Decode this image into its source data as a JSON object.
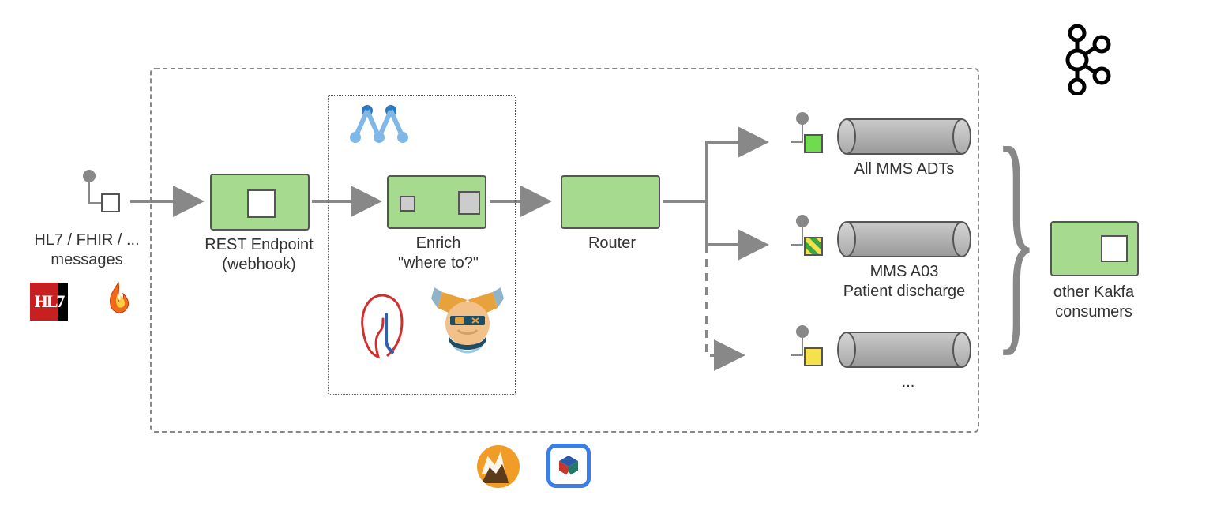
{
  "input": {
    "label": "HL7 / FHIR / ...\nmessages",
    "icons": [
      "hl7-logo",
      "fhir-flame-icon"
    ]
  },
  "pipeline_container": "dashed",
  "nodes": {
    "rest": {
      "label": "REST Endpoint\n(webhook)"
    },
    "enrich": {
      "label": "Enrich\n\"where to?\"",
      "icons_above": [
        "m-logo-icon"
      ],
      "icons_below": [
        "rules-engine-icon",
        "odin-icon"
      ]
    },
    "router": {
      "label": "Router"
    }
  },
  "outputs": [
    {
      "color": "green",
      "label": "All MMS ADTs"
    },
    {
      "color": "striped",
      "label": "MMS A03\nPatient discharge"
    },
    {
      "color": "yellow",
      "label": "..."
    }
  ],
  "right": {
    "top_icon": "kafka-icon",
    "consumer_label": "other Kakfa\nconsumers"
  },
  "bottom_icons": [
    "apache-camel-icon",
    "kaoto-cube-icon"
  ]
}
